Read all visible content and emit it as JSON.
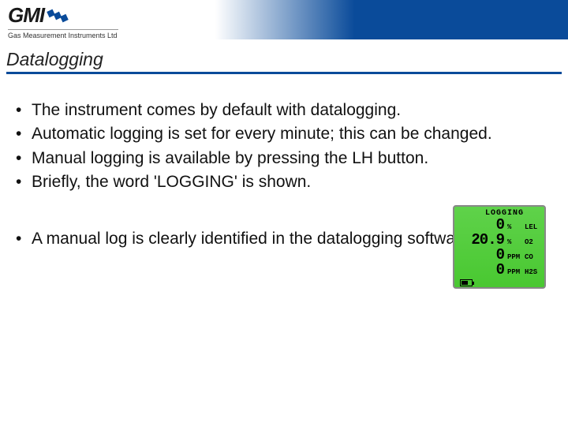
{
  "logo": {
    "brand": "GMI",
    "tagline": "Gas Measurement Instruments Ltd"
  },
  "title": "Datalogging",
  "bullets_top": [
    "The instrument comes by default with datalogging.",
    "Automatic logging is set for every minute; this can be changed.",
    "Manual logging is available by pressing the LH button.",
    "Briefly, the word 'LOGGING' is shown."
  ],
  "bullets_bottom": [
    "A manual log is clearly identified in the datalogging software."
  ],
  "lcd": {
    "title": "LOGGING",
    "rows": [
      {
        "value": "0",
        "unit": "%",
        "gas": "LEL"
      },
      {
        "value": "20.9",
        "unit": "%",
        "gas": "O2"
      },
      {
        "value": "0",
        "unit": "PPM",
        "gas": "CO"
      },
      {
        "value": "0",
        "unit": "PPM",
        "gas": "H2S"
      }
    ]
  }
}
